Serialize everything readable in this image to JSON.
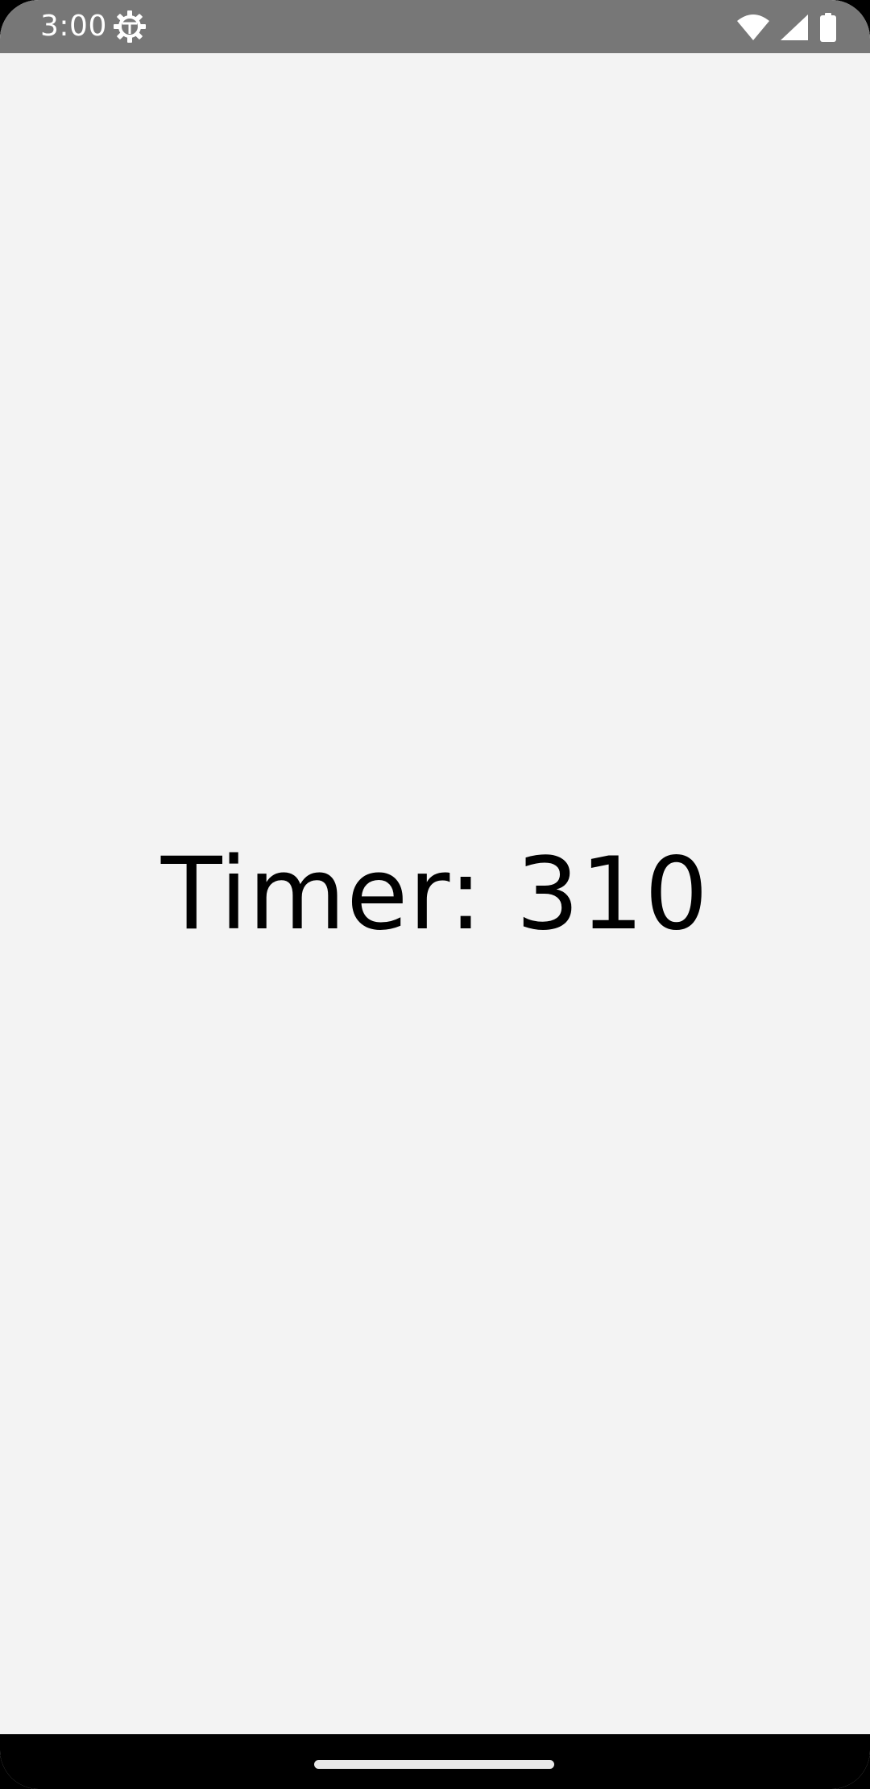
{
  "status_bar": {
    "time": "3:00",
    "icons": [
      "settings-gear-icon",
      "wifi-icon",
      "cellular-signal-icon",
      "battery-icon"
    ]
  },
  "main": {
    "timer_text": "Timer: 310"
  },
  "colors": {
    "status_bar_bg": "#777777",
    "screen_bg": "#f3f3f3",
    "nav_bar_bg": "#000000",
    "text": "#000000"
  }
}
